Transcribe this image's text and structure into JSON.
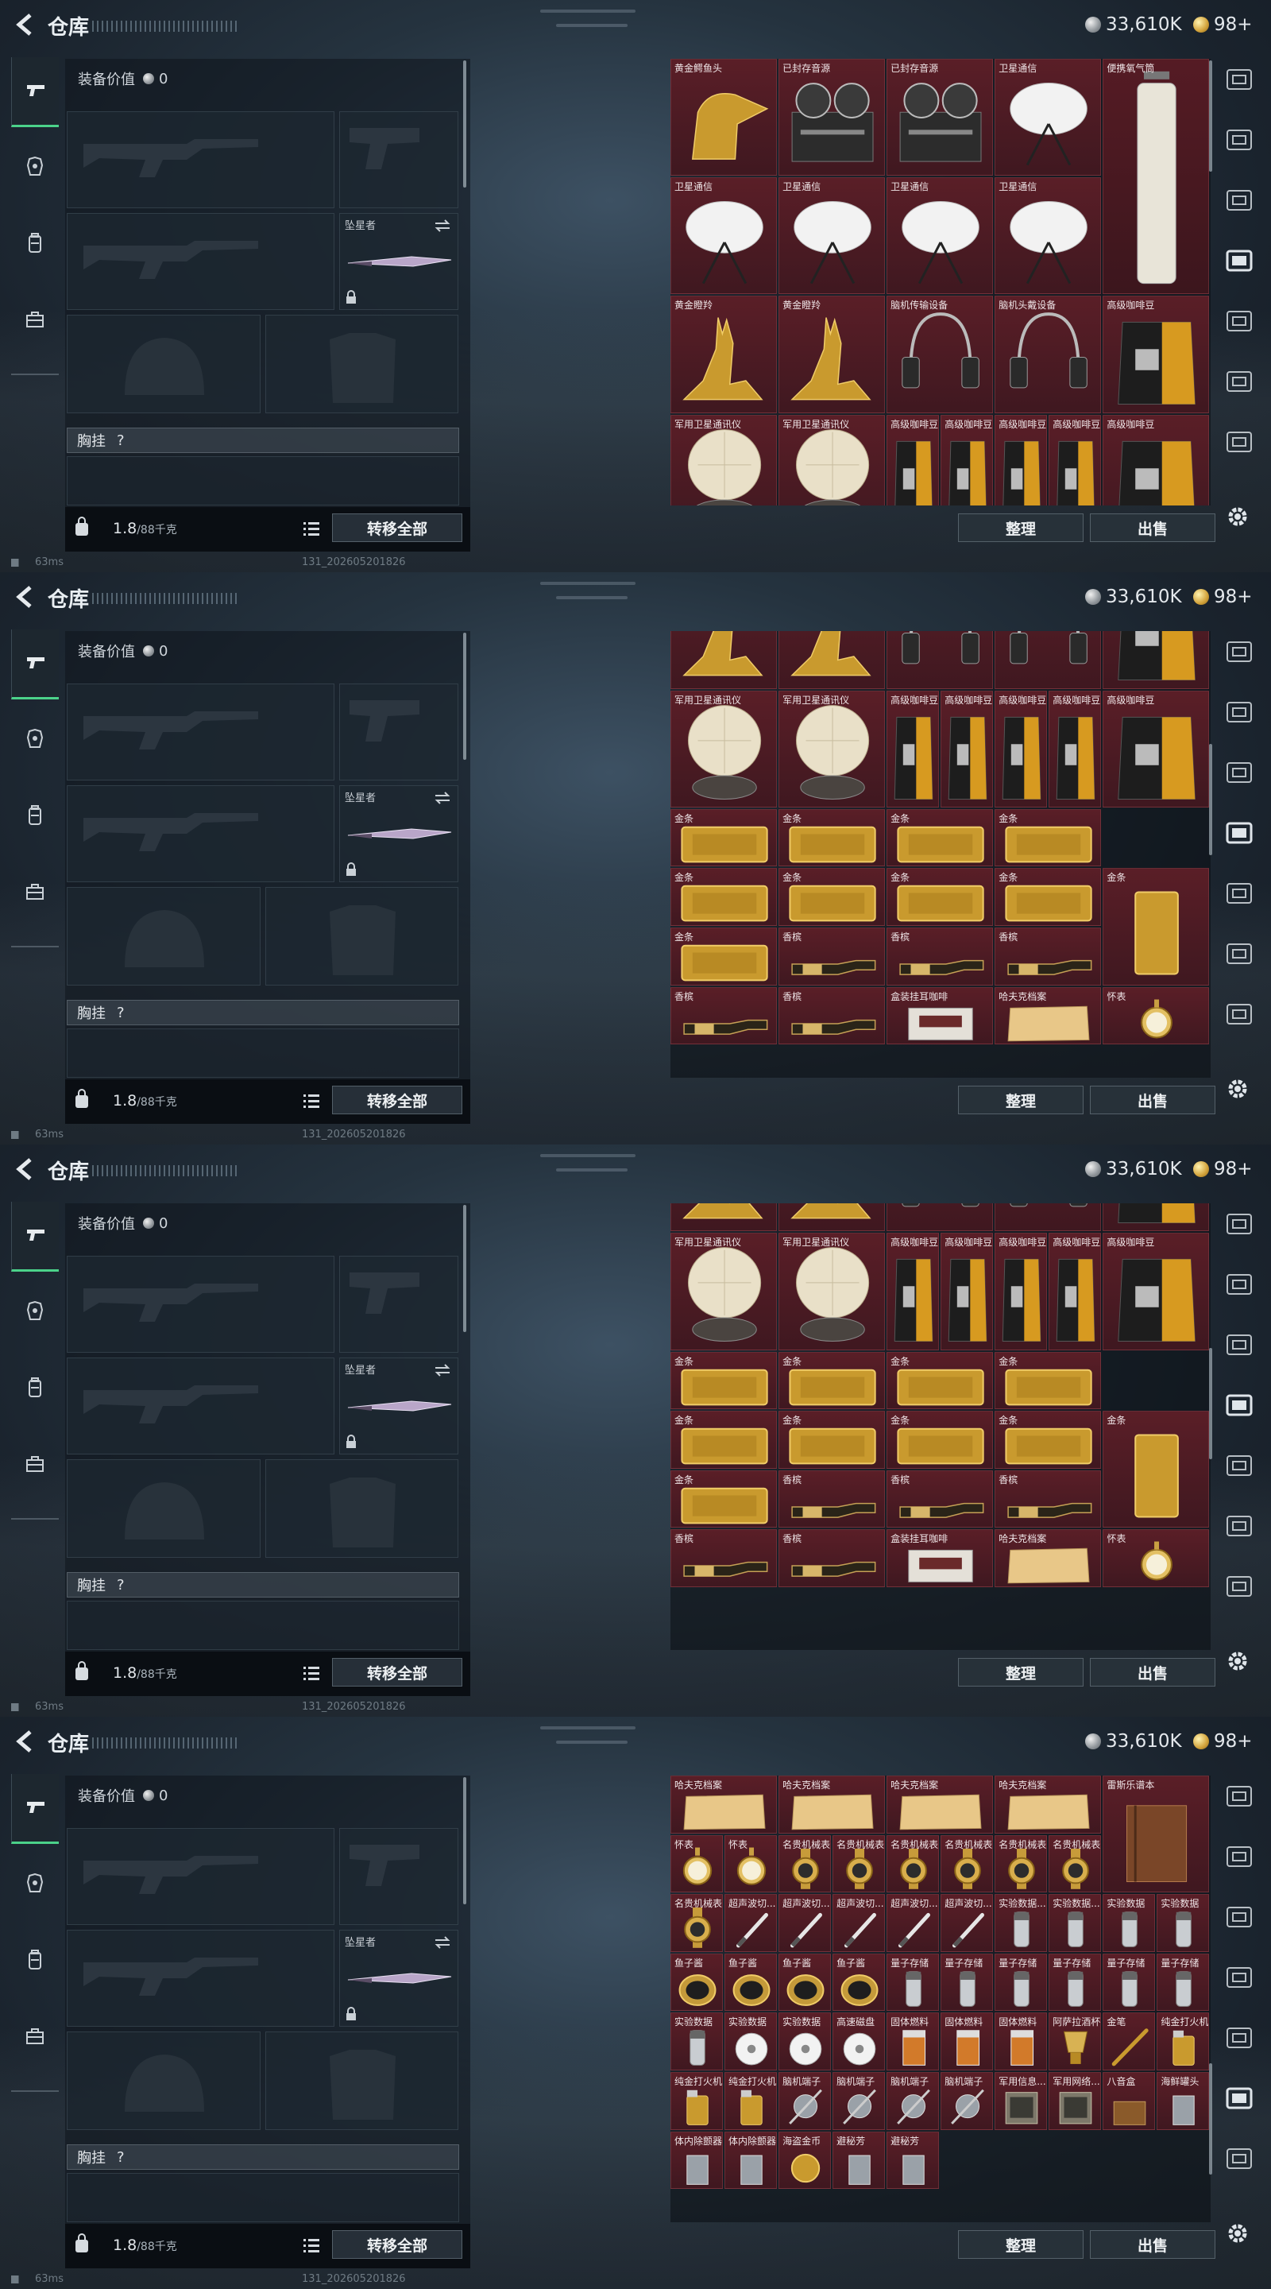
{
  "app": {
    "title": "仓库"
  },
  "currency": {
    "coins": "33,610K",
    "gold": "98+"
  },
  "loadout": {
    "equipment_value_label": "装备价值",
    "equipment_value": "0",
    "knife_label": "坠星者",
    "chest_rig_label": "胸挂",
    "chest_rig_value": "?",
    "weight_value": "1.8",
    "weight_max": "/88千克",
    "transfer_all": "转移全部"
  },
  "stash_buttons": {
    "sort": "整理",
    "sell": "出售"
  },
  "status": {
    "ping": "63ms",
    "build": "131_202605201826"
  },
  "icons": {
    "left_nav": [
      "pistol-icon",
      "armor-icon",
      "backpack-icon",
      "briefcase-icon"
    ],
    "right_nav": [
      "tab-icon-1",
      "tab-icon-2",
      "tab-icon-3",
      "tab-icon-4",
      "tab-icon-5",
      "tab-icon-6",
      "tab-icon-7"
    ]
  },
  "colors": {
    "accent_green": "#4bd28a",
    "item_bg": "#4a1b23",
    "panel_bg": "#151d24"
  },
  "frames": [
    {
      "scroll_fraction": 0.0,
      "items": [
        {
          "name": "黄金鳄鱼头",
          "art": "croc"
        },
        {
          "name": "已封存音源",
          "art": "reel"
        },
        {
          "name": "已封存音源",
          "art": "reel"
        },
        {
          "name": "卫星通信",
          "art": "dish"
        },
        {
          "name": "便携氧气筒",
          "art": "oxy"
        },
        {
          "name": "卫星通信",
          "art": "dish"
        },
        {
          "name": "卫星通信",
          "art": "dish"
        },
        {
          "name": "卫星通信",
          "art": "dish"
        },
        {
          "name": "卫星通信",
          "art": "dish"
        },
        {
          "name": "高级咖啡豆",
          "art": "coffee"
        },
        {
          "name": "黄金瞪羚",
          "art": "gazelle"
        },
        {
          "name": "黄金瞪羚",
          "art": "gazelle"
        },
        {
          "name": "脑机传输设备",
          "art": "headset"
        },
        {
          "name": "脑机头戴设备",
          "art": "headset"
        },
        {
          "name": "高级咖啡豆",
          "art": "coffee"
        },
        {
          "name": "军用卫星通讯仪",
          "art": "satcom"
        },
        {
          "name": "军用卫星通讯仪",
          "art": "satcom"
        },
        {
          "name": "高级咖啡豆",
          "art": "coffee"
        },
        {
          "name": "高级咖啡豆",
          "art": "coffee"
        },
        {
          "name": "高级咖啡豆",
          "art": "coffee"
        },
        {
          "name": "高级咖啡豆",
          "art": "coffee"
        },
        {
          "name": "高级咖啡豆",
          "art": "coffee"
        }
      ]
    },
    {
      "scroll_fraction": 0.35,
      "items": [
        {
          "name": "",
          "art": "gazelle"
        },
        {
          "name": "",
          "art": "gazelle"
        },
        {
          "name": "",
          "art": "headset"
        },
        {
          "name": "",
          "art": "headset"
        },
        {
          "name": "高级咖啡豆",
          "art": "coffee"
        },
        {
          "name": "军用卫星通讯仪",
          "art": "satcom"
        },
        {
          "name": "军用卫星通讯仪",
          "art": "satcom"
        },
        {
          "name": "高级咖啡豆",
          "art": "coffee"
        },
        {
          "name": "高级咖啡豆",
          "art": "coffee"
        },
        {
          "name": "高级咖啡豆",
          "art": "coffee"
        },
        {
          "name": "高级咖啡豆",
          "art": "coffee"
        },
        {
          "name": "高级咖啡豆",
          "art": "coffee"
        },
        {
          "name": "金条",
          "art": "goldbar"
        },
        {
          "name": "金条",
          "art": "goldbar"
        },
        {
          "name": "金条",
          "art": "goldbar"
        },
        {
          "name": "金条",
          "art": "goldbar"
        },
        {
          "name": "金条",
          "art": "goldbar"
        },
        {
          "name": "金条",
          "art": "goldbar"
        },
        {
          "name": "金条",
          "art": "goldbar"
        },
        {
          "name": "金条",
          "art": "goldbar"
        },
        {
          "name": "金条",
          "art": "goldbar_v"
        },
        {
          "name": "金条",
          "art": "goldbar"
        },
        {
          "name": "香槟",
          "art": "champagne"
        },
        {
          "name": "香槟",
          "art": "champagne"
        },
        {
          "name": "香槟",
          "art": "champagne"
        },
        {
          "name": "香槟",
          "art": "champagne"
        },
        {
          "name": "香槟",
          "art": "champagne"
        },
        {
          "name": "盒装挂耳咖啡",
          "art": "box"
        },
        {
          "name": "哈夫克档案",
          "art": "paper"
        },
        {
          "name": "怀表",
          "art": "watch"
        }
      ]
    },
    {
      "scroll_fraction": 0.45,
      "items": [
        {
          "name": "",
          "art": "gazelle"
        },
        {
          "name": "",
          "art": "gazelle"
        },
        {
          "name": "",
          "art": "headset"
        },
        {
          "name": "",
          "art": "headset"
        },
        {
          "name": "",
          "art": "coffee"
        },
        {
          "name": "军用卫星通讯仪",
          "art": "satcom"
        },
        {
          "name": "军用卫星通讯仪",
          "art": "satcom"
        },
        {
          "name": "高级咖啡豆",
          "art": "coffee"
        },
        {
          "name": "高级咖啡豆",
          "art": "coffee"
        },
        {
          "name": "高级咖啡豆",
          "art": "coffee"
        },
        {
          "name": "高级咖啡豆",
          "art": "coffee"
        },
        {
          "name": "高级咖啡豆",
          "art": "coffee"
        },
        {
          "name": "金条",
          "art": "goldbar"
        },
        {
          "name": "金条",
          "art": "goldbar"
        },
        {
          "name": "金条",
          "art": "goldbar"
        },
        {
          "name": "金条",
          "art": "goldbar"
        },
        {
          "name": "金条",
          "art": "goldbar"
        },
        {
          "name": "金条",
          "art": "goldbar"
        },
        {
          "name": "金条",
          "art": "goldbar"
        },
        {
          "name": "金条",
          "art": "goldbar"
        },
        {
          "name": "金条",
          "art": "goldbar_v"
        },
        {
          "name": "金条",
          "art": "goldbar"
        },
        {
          "name": "香槟",
          "art": "champagne"
        },
        {
          "name": "香槟",
          "art": "champagne"
        },
        {
          "name": "香槟",
          "art": "champagne"
        },
        {
          "name": "香槟",
          "art": "champagne"
        },
        {
          "name": "香槟",
          "art": "champagne"
        },
        {
          "name": "盒装挂耳咖啡",
          "art": "box"
        },
        {
          "name": "哈夫克档案",
          "art": "paper"
        },
        {
          "name": "怀表",
          "art": "watch"
        }
      ]
    },
    {
      "scroll_fraction": 0.9,
      "items": [
        {
          "name": "哈夫克档案",
          "art": "paper"
        },
        {
          "name": "哈夫克档案",
          "art": "paper"
        },
        {
          "name": "哈夫克档案",
          "art": "paper"
        },
        {
          "name": "哈夫克档案",
          "art": "paper"
        },
        {
          "name": "雷斯乐谱本",
          "art": "book"
        },
        {
          "name": "怀表",
          "art": "watch"
        },
        {
          "name": "怀表",
          "art": "watch"
        },
        {
          "name": "名贵机械表",
          "art": "luxwatch"
        },
        {
          "name": "名贵机械表",
          "art": "luxwatch"
        },
        {
          "name": "名贵机械表",
          "art": "luxwatch"
        },
        {
          "name": "名贵机械表",
          "art": "luxwatch"
        },
        {
          "name": "名贵机械表",
          "art": "luxwatch"
        },
        {
          "name": "名贵机械表",
          "art": "luxwatch"
        },
        {
          "name": "名贵机械表",
          "art": "luxwatch"
        },
        {
          "name": "超声波切...",
          "art": "pen"
        },
        {
          "name": "超声波切...",
          "art": "pen"
        },
        {
          "name": "超声波切...",
          "art": "pen"
        },
        {
          "name": "超声波切...",
          "art": "pen"
        },
        {
          "name": "超声波切...",
          "art": "pen"
        },
        {
          "name": "实验数据...",
          "art": "vial"
        },
        {
          "name": "实验数据...",
          "art": "vial"
        },
        {
          "name": "实验数据",
          "art": "vial"
        },
        {
          "name": "实验数据",
          "art": "vial"
        },
        {
          "name": "鱼子酱",
          "art": "caviar"
        },
        {
          "name": "鱼子酱",
          "art": "caviar"
        },
        {
          "name": "鱼子酱",
          "art": "caviar"
        },
        {
          "name": "鱼子酱",
          "art": "caviar"
        },
        {
          "name": "量子存储",
          "art": "vial"
        },
        {
          "name": "量子存储",
          "art": "vial"
        },
        {
          "name": "量子存储",
          "art": "vial"
        },
        {
          "name": "量子存储",
          "art": "vial"
        },
        {
          "name": "量子存储",
          "art": "vial"
        },
        {
          "name": "量子存储",
          "art": "vial"
        },
        {
          "name": "实验数据",
          "art": "vial"
        },
        {
          "name": "实验数据",
          "art": "disc"
        },
        {
          "name": "实验数据",
          "art": "disc"
        },
        {
          "name": "高速磁盘",
          "art": "disc"
        },
        {
          "name": "固体燃料",
          "art": "fuel"
        },
        {
          "name": "固体燃料",
          "art": "fuel"
        },
        {
          "name": "固体燃料",
          "art": "fuel"
        },
        {
          "name": "阿萨拉酒杯",
          "art": "cup"
        },
        {
          "name": "金笔",
          "art": "goldpen"
        },
        {
          "name": "纯金打火机",
          "art": "lighter"
        },
        {
          "name": "纯金打火机",
          "art": "lighter"
        },
        {
          "name": "纯金打火机",
          "art": "lighter"
        },
        {
          "name": "脑机端子",
          "art": "jack"
        },
        {
          "name": "脑机端子",
          "art": "jack"
        },
        {
          "name": "脑机端子",
          "art": "jack"
        },
        {
          "name": "脑机端子",
          "art": "jack"
        },
        {
          "name": "军用信息...",
          "art": "tablet"
        },
        {
          "name": "军用网络...",
          "art": "tablet"
        },
        {
          "name": "八音盒",
          "art": "musicbox"
        },
        {
          "name": "海鲜罐头",
          "art": "can"
        },
        {
          "name": "体内除颤器",
          "art": "can"
        },
        {
          "name": "体内除颤器",
          "art": "can"
        },
        {
          "name": "海盗金币",
          "art": "coin"
        },
        {
          "name": "避秘芳",
          "art": "can"
        },
        {
          "name": "避秘芳",
          "art": "can"
        }
      ]
    }
  ]
}
